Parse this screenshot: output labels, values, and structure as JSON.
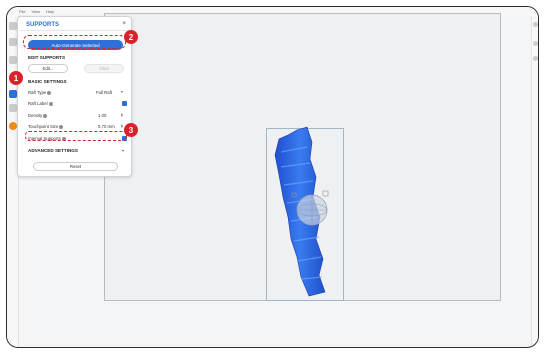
{
  "menubar": {
    "items": [
      "File",
      "View",
      "Help"
    ]
  },
  "panel": {
    "title": "SUPPORTS",
    "close": "×",
    "auto_generate_label": "Auto-Generate Selected",
    "edit_supports_heading": "EDIT SUPPORTS",
    "edit_label": "Edit...",
    "clear_label": "Clear",
    "basic_settings_heading": "BASIC SETTINGS",
    "raft_type_label": "Raft Type",
    "raft_type_value": "Full Raft",
    "raft_label_label": "Raft Label",
    "density_label": "Density",
    "density_value": "1.00",
    "touchpoint_label": "Touchpoint Size",
    "touchpoint_value": "0.70 mm",
    "internal_supports_label": "Internal Supports",
    "advanced_settings_heading": "ADVANCED SETTINGS",
    "reset_label": "Reset"
  },
  "badges": [
    "1",
    "2",
    "3"
  ],
  "colors": {
    "accent": "#2f6fd8",
    "highlight": "#d9222a",
    "model": "#2f6fe6"
  }
}
